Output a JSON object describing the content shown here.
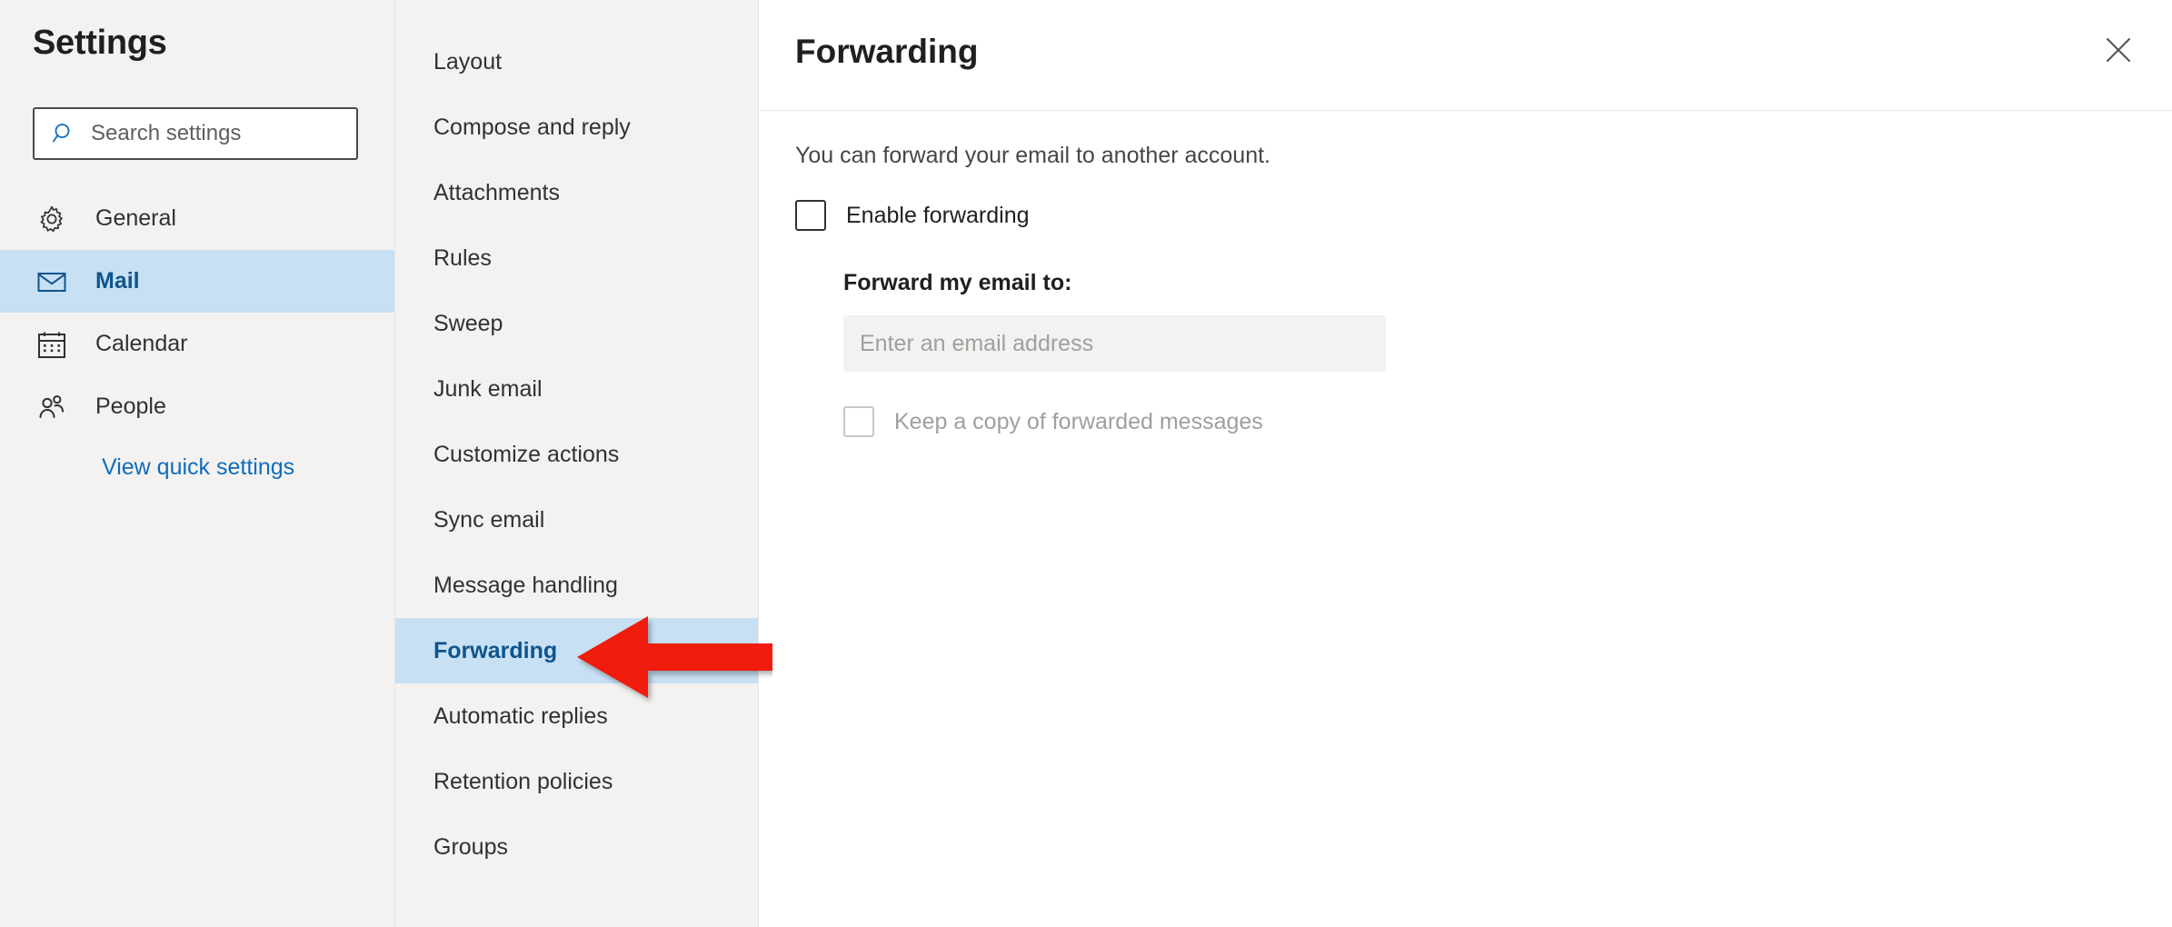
{
  "sidebar": {
    "title": "Settings",
    "search": {
      "placeholder": "Search settings",
      "value": "",
      "icon": "search-icon"
    },
    "items": [
      {
        "label": "General",
        "icon": "gear-icon",
        "selected": false
      },
      {
        "label": "Mail",
        "icon": "envelope-icon",
        "selected": true
      },
      {
        "label": "Calendar",
        "icon": "calendar-icon",
        "selected": false
      },
      {
        "label": "People",
        "icon": "people-icon",
        "selected": false
      }
    ],
    "quick_settings_link": "View quick settings"
  },
  "midcolumn": {
    "items": [
      {
        "label": "Layout",
        "selected": false
      },
      {
        "label": "Compose and reply",
        "selected": false
      },
      {
        "label": "Attachments",
        "selected": false
      },
      {
        "label": "Rules",
        "selected": false
      },
      {
        "label": "Sweep",
        "selected": false
      },
      {
        "label": "Junk email",
        "selected": false
      },
      {
        "label": "Customize actions",
        "selected": false
      },
      {
        "label": "Sync email",
        "selected": false
      },
      {
        "label": "Message handling",
        "selected": false
      },
      {
        "label": "Forwarding",
        "selected": true
      },
      {
        "label": "Automatic replies",
        "selected": false
      },
      {
        "label": "Retention policies",
        "selected": false
      },
      {
        "label": "Groups",
        "selected": false
      }
    ]
  },
  "content": {
    "title": "Forwarding",
    "close_icon": "close-icon",
    "description": "You can forward your email to another account.",
    "enable_forwarding": {
      "label": "Enable forwarding",
      "checked": false,
      "disabled": false
    },
    "forward_to": {
      "label": "Forward my email to:",
      "placeholder": "Enter an email address",
      "value": ""
    },
    "keep_copy": {
      "label": "Keep a copy of forwarded messages",
      "checked": false,
      "disabled": true
    }
  },
  "annotation": {
    "arrow": {
      "name": "red-arrow-pointing-to-forwarding",
      "color": "#f01f0f",
      "direction": "left",
      "target": "Forwarding"
    }
  },
  "colors": {
    "accent": "#0f6cbd",
    "selected_bg": "#c7e0f4",
    "selected_text": "#0f548c",
    "panel_bg": "#f3f2f1",
    "content_bg": "#ffffff",
    "arrow_red": "#f01f0f"
  }
}
